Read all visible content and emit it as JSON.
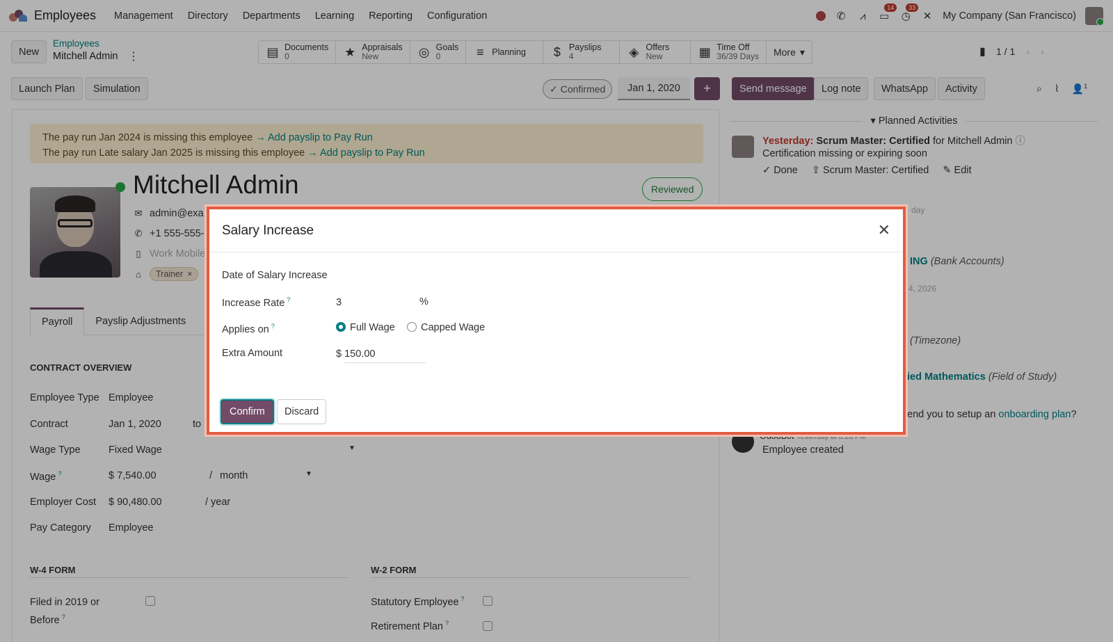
{
  "topbar": {
    "app_name": "Employees",
    "menu": [
      "Management",
      "Directory",
      "Departments",
      "Learning",
      "Reporting",
      "Configuration"
    ],
    "badge_messages": "14",
    "badge_activities": "33",
    "company": "My Company (San Francisco)"
  },
  "control": {
    "new_label": "New",
    "breadcrumb_parent": "Employees",
    "breadcrumb_current": "Mitchell Admin",
    "smart_buttons": [
      {
        "label": "Documents",
        "sub": "0"
      },
      {
        "label": "Appraisals",
        "sub": "New"
      },
      {
        "label": "Goals",
        "sub": "0"
      },
      {
        "label": "Planning",
        "sub": ""
      },
      {
        "label": "Payslips",
        "sub": "4"
      },
      {
        "label": "Offers",
        "sub": "New"
      },
      {
        "label": "Time Off",
        "sub": "36/39 Days"
      }
    ],
    "more_label": "More",
    "pager": "1 / 1"
  },
  "actions": {
    "launch_plan": "Launch Plan",
    "simulation": "Simulation",
    "status": "Confirmed",
    "date": "Jan 1, 2020",
    "plus": "+",
    "send_message": "Send message",
    "log_note": "Log note",
    "whatsapp": "WhatsApp",
    "activity": "Activity",
    "followers_count": "1"
  },
  "form": {
    "alert_line1": "The pay run Jan 2024 is missing this employee",
    "alert_line2": "The pay run Late salary Jan 2025 is missing this employee",
    "alert_link": "Add payslip to Pay Run",
    "employee_name": "Mitchell Admin",
    "reviewed": "Reviewed",
    "email": "admin@exa",
    "phone": "+1 555-555-",
    "work_mobile_placeholder": "Work Mobile",
    "tag": "Trainer",
    "tabs": [
      "Payroll",
      "Payslip Adjustments"
    ],
    "contract_overview": "CONTRACT OVERVIEW",
    "fields": {
      "employee_type_label": "Employee Type",
      "employee_type": "Employee",
      "contract_label": "Contract",
      "contract": "Jan 1, 2020",
      "contract_to": "to",
      "wage_type_label": "Wage Type",
      "wage_type": "Fixed Wage",
      "wage_label": "Wage",
      "wage": "$ 7,540.00",
      "wage_sep": "/",
      "wage_period": "month",
      "employer_cost_label": "Employer Cost",
      "employer_cost": "$ 90,480.00",
      "employer_cost_period": "/ year",
      "pay_category_label": "Pay Category",
      "pay_category": "Employee"
    },
    "w4_title": "W-4 FORM",
    "w2_title": "W-2 FORM",
    "filed_label_1": "Filed in 2019 or",
    "filed_label_2": "Before",
    "statutory_label": "Statutory Employee",
    "retirement_label": "Retirement Plan"
  },
  "chatter": {
    "planned_activities": "Planned Activities",
    "act_when": "Yesterday:",
    "act_title": "Scrum Master: Certified",
    "act_for": "for Mitchell Admin",
    "act_desc": "Certification missing or expiring soon",
    "act_done": "Done",
    "act_upload": "Scrum Master: Certified",
    "act_edit": "Edit",
    "frag_day": "day",
    "frag_bank": "ING",
    "frag_bank_field": "(Bank Accounts)",
    "frag_date": "4, 2026",
    "frag_tz": "(Timezone)",
    "frag_study": "ied Mathematics",
    "frag_study_field": "(Field of Study)",
    "frag_onboard": "end you to setup an",
    "frag_onboard_link": "onboarding plan",
    "frag_q": "?",
    "bot_name": "OdooBot",
    "bot_time": "Yesterday at 8:28 PM",
    "bot_msg": "Employee created"
  },
  "modal": {
    "title": "Salary Increase",
    "date_label": "Date of Salary Increase",
    "rate_label": "Increase Rate",
    "rate_value": "3",
    "rate_unit": "%",
    "applies_label": "Applies on",
    "opt_full": "Full Wage",
    "opt_capped": "Capped Wage",
    "extra_label": "Extra Amount",
    "extra_value": "$ 150.00",
    "confirm": "Confirm",
    "discard": "Discard"
  }
}
